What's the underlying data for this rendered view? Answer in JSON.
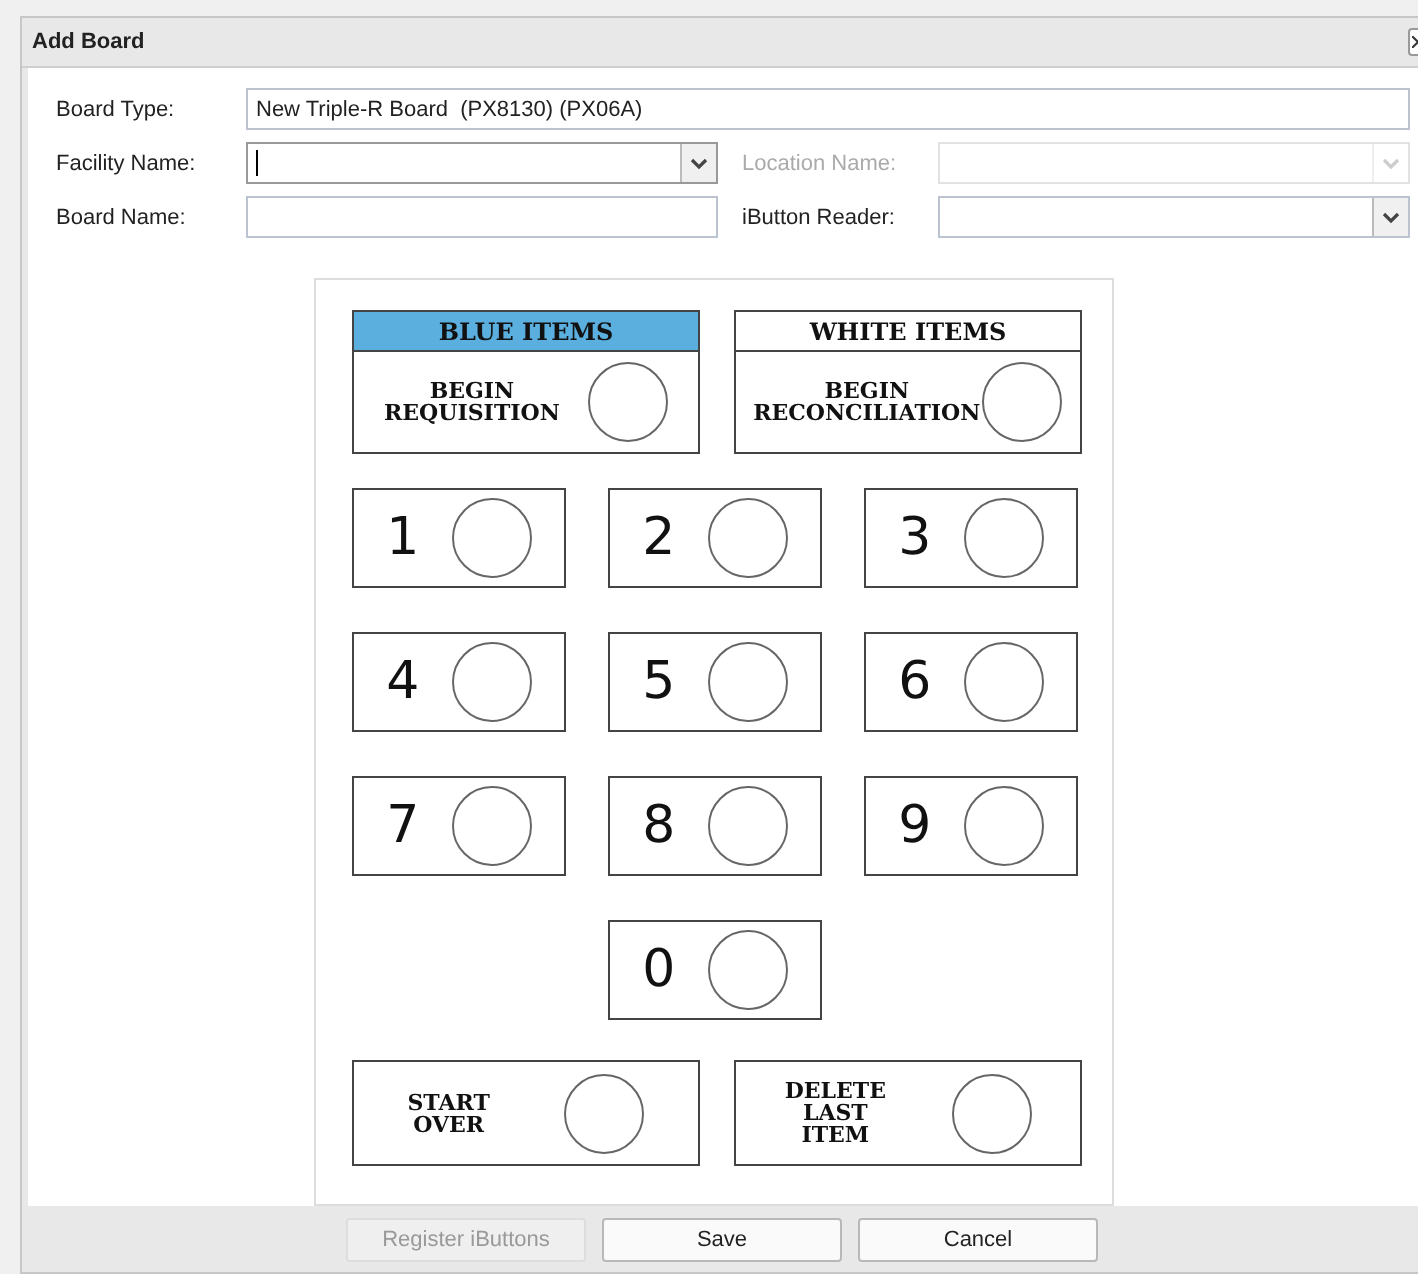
{
  "window": {
    "title": "Add Board"
  },
  "fields": [
    {
      "label": "Board Type:",
      "kind": "text",
      "value": "New Triple-R Board  (PX8130) (PX06A)",
      "disabled": false,
      "focused": false
    },
    {
      "label": "Facility Name:",
      "kind": "select",
      "disabled": false,
      "focused": true
    },
    {
      "label": "Location Name:",
      "kind": "select",
      "disabled": true,
      "focused": false
    },
    {
      "label": "Board Name:",
      "kind": "text",
      "disabled": false,
      "focused": false
    },
    {
      "label": "iButton Reader:",
      "kind": "select",
      "disabled": false,
      "focused": false
    }
  ],
  "mode_tiles": [
    {
      "header": "BLUE ITEMS",
      "color": "#5aafdf",
      "lines": [
        "BEGIN",
        "REQUISITION"
      ]
    },
    {
      "header": "WHITE ITEMS",
      "color": "#ffffff",
      "lines": [
        "BEGIN",
        "RECONCILIATION"
      ]
    }
  ],
  "keys": [
    "1",
    "2",
    "3",
    "4",
    "5",
    "6",
    "7",
    "8",
    "9",
    "0"
  ],
  "action_tiles": [
    {
      "lines": [
        "START",
        "OVER"
      ]
    },
    {
      "lines": [
        "DELETE",
        "LAST",
        "ITEM"
      ]
    }
  ],
  "buttons": [
    {
      "label": "Register iButtons",
      "disabled": true
    },
    {
      "label": "Save",
      "disabled": false
    },
    {
      "label": "Cancel",
      "disabled": false
    }
  ]
}
